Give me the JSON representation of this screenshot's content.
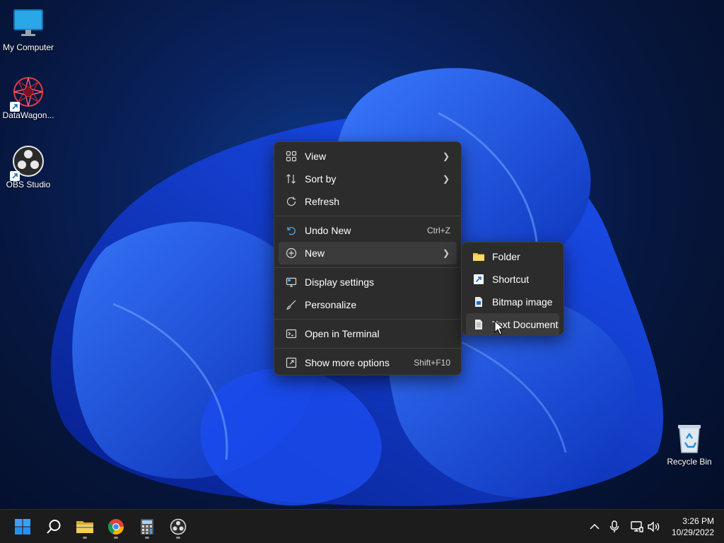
{
  "desktop": {
    "icons": [
      {
        "name": "my-computer",
        "label": "My Computer"
      },
      {
        "name": "datawagon",
        "label": "DataWagon..."
      },
      {
        "name": "obs-studio",
        "label": "OBS Studio"
      },
      {
        "name": "recycle-bin",
        "label": "Recycle Bin"
      }
    ]
  },
  "context_menu": {
    "items": [
      {
        "label": "View",
        "icon": "view-grid-icon",
        "submenu": true
      },
      {
        "label": "Sort by",
        "icon": "sort-icon",
        "submenu": true
      },
      {
        "label": "Refresh",
        "icon": "refresh-icon"
      },
      {
        "label": "Undo New",
        "icon": "undo-icon",
        "shortcut": "Ctrl+Z"
      },
      {
        "label": "New",
        "icon": "new-plus-icon",
        "submenu": true,
        "highlighted": true
      },
      {
        "label": "Display settings",
        "icon": "display-icon"
      },
      {
        "label": "Personalize",
        "icon": "brush-icon"
      },
      {
        "label": "Open in Terminal",
        "icon": "terminal-icon"
      },
      {
        "label": "Show more options",
        "icon": "more-options-icon",
        "shortcut": "Shift+F10"
      }
    ]
  },
  "new_submenu": {
    "items": [
      {
        "label": "Folder",
        "icon": "folder-icon"
      },
      {
        "label": "Shortcut",
        "icon": "shortcut-icon"
      },
      {
        "label": "Bitmap image",
        "icon": "bitmap-icon"
      },
      {
        "label": "Text Document",
        "icon": "text-document-icon",
        "highlighted": true
      }
    ]
  },
  "taskbar": {
    "apps": [
      "start-icon",
      "search-icon",
      "file-explorer-icon",
      "chrome-icon",
      "calculator-icon",
      "obs-icon"
    ],
    "tray": [
      "chevron-up-icon",
      "microphone-icon",
      "network-icon",
      "volume-icon"
    ],
    "clock": {
      "time": "3:26 PM",
      "date": "10/29/2022"
    }
  },
  "colors": {
    "menu_bg": "#2c2c2c",
    "accent": "#0078d4",
    "folder": "#f2c14e"
  }
}
